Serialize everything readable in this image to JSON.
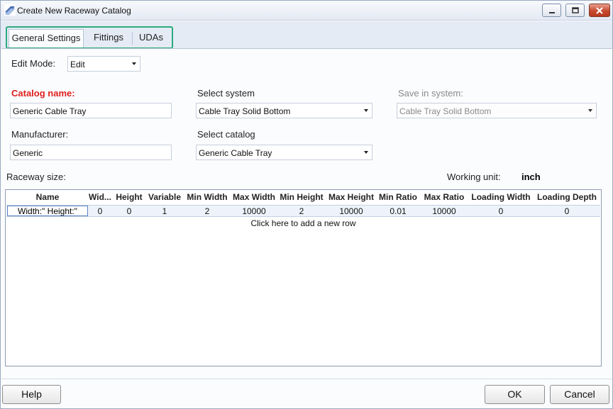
{
  "window": {
    "title": "Create New Raceway Catalog"
  },
  "tabs": [
    {
      "label": "General Settings",
      "active": true
    },
    {
      "label": "Fittings",
      "active": false
    },
    {
      "label": "UDAs",
      "active": false
    }
  ],
  "edit_mode": {
    "label": "Edit Mode:",
    "value": "Edit"
  },
  "catalog_name": {
    "label": "Catalog name:",
    "value": "Generic Cable Tray"
  },
  "select_system": {
    "label": "Select system",
    "value": "Cable Tray Solid Bottom"
  },
  "save_in_system": {
    "label": "Save in system:",
    "value": "Cable Tray Solid Bottom"
  },
  "manufacturer": {
    "label": "Manufacturer:",
    "value": "Generic"
  },
  "select_catalog": {
    "label": "Select catalog",
    "value": "Generic Cable Tray"
  },
  "raceway_size": {
    "label": "Raceway size:"
  },
  "working_unit": {
    "label": "Working unit:",
    "value": "inch"
  },
  "grid": {
    "columns": [
      "Name",
      "Wid...",
      "Height",
      "Variable",
      "Min Width",
      "Max Width",
      "Min Height",
      "Max Height",
      "Min Ratio",
      "Max Ratio",
      "Loading Width",
      "Loading Depth"
    ],
    "rows": [
      [
        "Width:\" Height:\"",
        "0",
        "0",
        "1",
        "2",
        "10000",
        "2",
        "10000",
        "0.01",
        "10000",
        "0",
        "0"
      ]
    ],
    "add_row_text": "Click here to add a new row"
  },
  "buttons": {
    "help": "Help",
    "ok": "OK",
    "cancel": "Cancel"
  },
  "colors": {
    "accent_highlight": "#2eaa7e",
    "required_label": "#e02020",
    "close_button": "#c74a2f"
  }
}
